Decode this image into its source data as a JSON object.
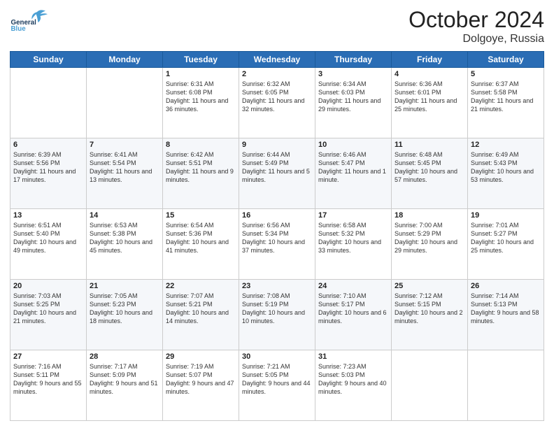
{
  "header": {
    "logo_general": "General",
    "logo_blue": "Blue",
    "month": "October 2024",
    "location": "Dolgoye, Russia"
  },
  "days_of_week": [
    "Sunday",
    "Monday",
    "Tuesday",
    "Wednesday",
    "Thursday",
    "Friday",
    "Saturday"
  ],
  "weeks": [
    [
      {
        "day": "",
        "sunrise": "",
        "sunset": "",
        "daylight": ""
      },
      {
        "day": "",
        "sunrise": "",
        "sunset": "",
        "daylight": ""
      },
      {
        "day": "1",
        "sunrise": "Sunrise: 6:31 AM",
        "sunset": "Sunset: 6:08 PM",
        "daylight": "Daylight: 11 hours and 36 minutes."
      },
      {
        "day": "2",
        "sunrise": "Sunrise: 6:32 AM",
        "sunset": "Sunset: 6:05 PM",
        "daylight": "Daylight: 11 hours and 32 minutes."
      },
      {
        "day": "3",
        "sunrise": "Sunrise: 6:34 AM",
        "sunset": "Sunset: 6:03 PM",
        "daylight": "Daylight: 11 hours and 29 minutes."
      },
      {
        "day": "4",
        "sunrise": "Sunrise: 6:36 AM",
        "sunset": "Sunset: 6:01 PM",
        "daylight": "Daylight: 11 hours and 25 minutes."
      },
      {
        "day": "5",
        "sunrise": "Sunrise: 6:37 AM",
        "sunset": "Sunset: 5:58 PM",
        "daylight": "Daylight: 11 hours and 21 minutes."
      }
    ],
    [
      {
        "day": "6",
        "sunrise": "Sunrise: 6:39 AM",
        "sunset": "Sunset: 5:56 PM",
        "daylight": "Daylight: 11 hours and 17 minutes."
      },
      {
        "day": "7",
        "sunrise": "Sunrise: 6:41 AM",
        "sunset": "Sunset: 5:54 PM",
        "daylight": "Daylight: 11 hours and 13 minutes."
      },
      {
        "day": "8",
        "sunrise": "Sunrise: 6:42 AM",
        "sunset": "Sunset: 5:51 PM",
        "daylight": "Daylight: 11 hours and 9 minutes."
      },
      {
        "day": "9",
        "sunrise": "Sunrise: 6:44 AM",
        "sunset": "Sunset: 5:49 PM",
        "daylight": "Daylight: 11 hours and 5 minutes."
      },
      {
        "day": "10",
        "sunrise": "Sunrise: 6:46 AM",
        "sunset": "Sunset: 5:47 PM",
        "daylight": "Daylight: 11 hours and 1 minute."
      },
      {
        "day": "11",
        "sunrise": "Sunrise: 6:48 AM",
        "sunset": "Sunset: 5:45 PM",
        "daylight": "Daylight: 10 hours and 57 minutes."
      },
      {
        "day": "12",
        "sunrise": "Sunrise: 6:49 AM",
        "sunset": "Sunset: 5:43 PM",
        "daylight": "Daylight: 10 hours and 53 minutes."
      }
    ],
    [
      {
        "day": "13",
        "sunrise": "Sunrise: 6:51 AM",
        "sunset": "Sunset: 5:40 PM",
        "daylight": "Daylight: 10 hours and 49 minutes."
      },
      {
        "day": "14",
        "sunrise": "Sunrise: 6:53 AM",
        "sunset": "Sunset: 5:38 PM",
        "daylight": "Daylight: 10 hours and 45 minutes."
      },
      {
        "day": "15",
        "sunrise": "Sunrise: 6:54 AM",
        "sunset": "Sunset: 5:36 PM",
        "daylight": "Daylight: 10 hours and 41 minutes."
      },
      {
        "day": "16",
        "sunrise": "Sunrise: 6:56 AM",
        "sunset": "Sunset: 5:34 PM",
        "daylight": "Daylight: 10 hours and 37 minutes."
      },
      {
        "day": "17",
        "sunrise": "Sunrise: 6:58 AM",
        "sunset": "Sunset: 5:32 PM",
        "daylight": "Daylight: 10 hours and 33 minutes."
      },
      {
        "day": "18",
        "sunrise": "Sunrise: 7:00 AM",
        "sunset": "Sunset: 5:29 PM",
        "daylight": "Daylight: 10 hours and 29 minutes."
      },
      {
        "day": "19",
        "sunrise": "Sunrise: 7:01 AM",
        "sunset": "Sunset: 5:27 PM",
        "daylight": "Daylight: 10 hours and 25 minutes."
      }
    ],
    [
      {
        "day": "20",
        "sunrise": "Sunrise: 7:03 AM",
        "sunset": "Sunset: 5:25 PM",
        "daylight": "Daylight: 10 hours and 21 minutes."
      },
      {
        "day": "21",
        "sunrise": "Sunrise: 7:05 AM",
        "sunset": "Sunset: 5:23 PM",
        "daylight": "Daylight: 10 hours and 18 minutes."
      },
      {
        "day": "22",
        "sunrise": "Sunrise: 7:07 AM",
        "sunset": "Sunset: 5:21 PM",
        "daylight": "Daylight: 10 hours and 14 minutes."
      },
      {
        "day": "23",
        "sunrise": "Sunrise: 7:08 AM",
        "sunset": "Sunset: 5:19 PM",
        "daylight": "Daylight: 10 hours and 10 minutes."
      },
      {
        "day": "24",
        "sunrise": "Sunrise: 7:10 AM",
        "sunset": "Sunset: 5:17 PM",
        "daylight": "Daylight: 10 hours and 6 minutes."
      },
      {
        "day": "25",
        "sunrise": "Sunrise: 7:12 AM",
        "sunset": "Sunset: 5:15 PM",
        "daylight": "Daylight: 10 hours and 2 minutes."
      },
      {
        "day": "26",
        "sunrise": "Sunrise: 7:14 AM",
        "sunset": "Sunset: 5:13 PM",
        "daylight": "Daylight: 9 hours and 58 minutes."
      }
    ],
    [
      {
        "day": "27",
        "sunrise": "Sunrise: 7:16 AM",
        "sunset": "Sunset: 5:11 PM",
        "daylight": "Daylight: 9 hours and 55 minutes."
      },
      {
        "day": "28",
        "sunrise": "Sunrise: 7:17 AM",
        "sunset": "Sunset: 5:09 PM",
        "daylight": "Daylight: 9 hours and 51 minutes."
      },
      {
        "day": "29",
        "sunrise": "Sunrise: 7:19 AM",
        "sunset": "Sunset: 5:07 PM",
        "daylight": "Daylight: 9 hours and 47 minutes."
      },
      {
        "day": "30",
        "sunrise": "Sunrise: 7:21 AM",
        "sunset": "Sunset: 5:05 PM",
        "daylight": "Daylight: 9 hours and 44 minutes."
      },
      {
        "day": "31",
        "sunrise": "Sunrise: 7:23 AM",
        "sunset": "Sunset: 5:03 PM",
        "daylight": "Daylight: 9 hours and 40 minutes."
      },
      {
        "day": "",
        "sunrise": "",
        "sunset": "",
        "daylight": ""
      },
      {
        "day": "",
        "sunrise": "",
        "sunset": "",
        "daylight": ""
      }
    ]
  ]
}
